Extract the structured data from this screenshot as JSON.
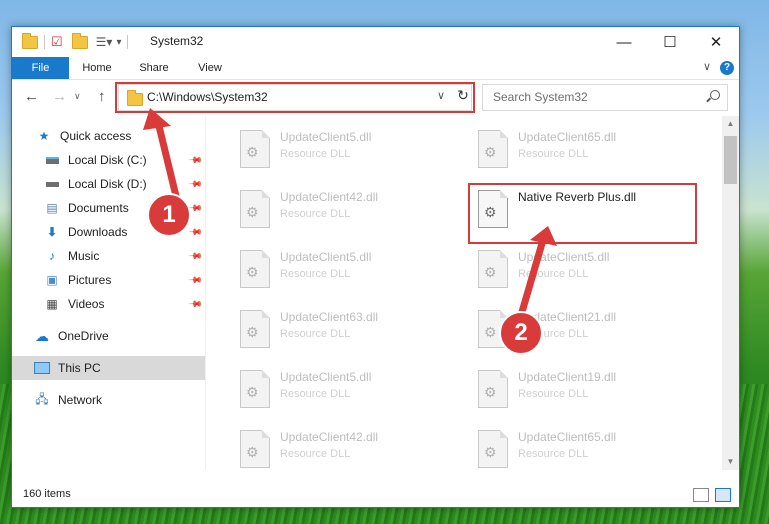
{
  "window": {
    "title": "System32",
    "controls": {
      "minimize": "—",
      "maximize": "☐",
      "close": "✕"
    }
  },
  "ribbon": {
    "tabs": [
      "File",
      "Home",
      "Share",
      "View"
    ],
    "help": "?"
  },
  "address": {
    "path": "C:\\Windows\\System32",
    "search_placeholder": "Search System32"
  },
  "sidebar": {
    "items": [
      {
        "label": "Quick access",
        "icon": "star-icon",
        "pinned": false
      },
      {
        "label": "Local Disk (C:)",
        "icon": "disk-icon",
        "pinned": true
      },
      {
        "label": "Local Disk (D:)",
        "icon": "disk-icon",
        "pinned": true
      },
      {
        "label": "Documents",
        "icon": "documents-icon",
        "pinned": true
      },
      {
        "label": "Downloads",
        "icon": "download-icon",
        "pinned": true
      },
      {
        "label": "Music",
        "icon": "music-icon",
        "pinned": true
      },
      {
        "label": "Pictures",
        "icon": "pictures-icon",
        "pinned": true
      },
      {
        "label": "Videos",
        "icon": "videos-icon",
        "pinned": true
      },
      {
        "label": "OneDrive",
        "icon": "cloud-icon",
        "pinned": false
      },
      {
        "label": "This PC",
        "icon": "computer-icon",
        "pinned": false,
        "selected": true
      },
      {
        "label": "Network",
        "icon": "network-icon",
        "pinned": false
      }
    ]
  },
  "files": [
    {
      "name": "UpdateClient5.dll",
      "type": "Resource DLL"
    },
    {
      "name": "UpdateClient65.dll",
      "type": "Resource DLL"
    },
    {
      "name": "UpdateClient42.dll",
      "type": "Resource DLL"
    },
    {
      "name": "Native Reverb Plus.dll",
      "type": "",
      "highlighted": true
    },
    {
      "name": "UpdateClient5.dll",
      "type": "Resource DLL"
    },
    {
      "name": "UpdateClient5.dll",
      "type": "Resource DLL"
    },
    {
      "name": "UpdateClient63.dll",
      "type": "Resource DLL"
    },
    {
      "name": "UpdateClient21.dll",
      "type": "Resource DLL"
    },
    {
      "name": "UpdateClient5.dll",
      "type": "Resource DLL"
    },
    {
      "name": "UpdateClient19.dll",
      "type": "Resource DLL"
    },
    {
      "name": "UpdateClient42.dll",
      "type": "Resource DLL"
    },
    {
      "name": "UpdateClient65.dll",
      "type": "Resource DLL"
    }
  ],
  "status": {
    "item_count": "160 items"
  },
  "annotations": {
    "step1": "1",
    "step2": "2"
  },
  "colors": {
    "accent": "#1979ca",
    "annotation": "#d93a3a"
  }
}
